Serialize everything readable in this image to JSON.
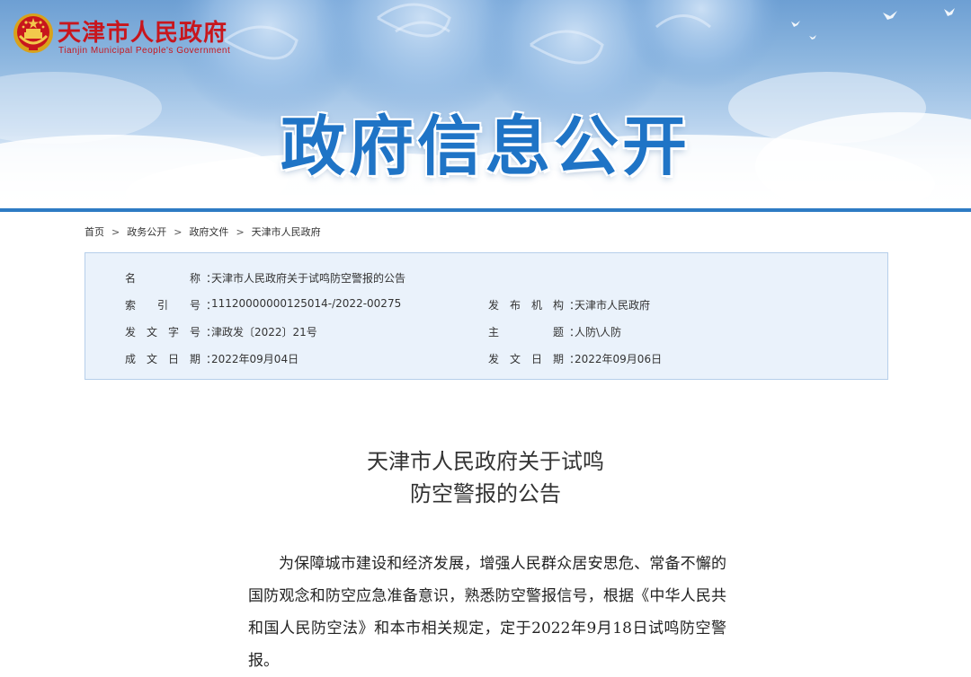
{
  "header": {
    "logo_cn": "天津市人民政府",
    "logo_en": "Tianjin Municipal People's Government",
    "banner_title": "政府信息公开"
  },
  "breadcrumb": {
    "items": [
      "首页",
      "政务公开",
      "政府文件",
      "天津市人民政府"
    ],
    "separator": ">"
  },
  "info": {
    "name": {
      "label": "名称",
      "value": "天津市人民政府关于试鸣防空警报的公告"
    },
    "index_no": {
      "label": "索引号",
      "value": "11120000000125014-/2022-00275"
    },
    "issuer": {
      "label": "发布机构",
      "value": "天津市人民政府"
    },
    "doc_no": {
      "label": "发文字号",
      "value": "津政发〔2022〕21号"
    },
    "subject": {
      "label": "主题",
      "value": "人防\\人防"
    },
    "created_date": {
      "label": "成文日期",
      "value": "2022年09月04日"
    },
    "issued_date": {
      "label": "发文日期",
      "value": "2022年09月06日"
    },
    "colon": "："
  },
  "article": {
    "title_line1": "天津市人民政府关于试鸣",
    "title_line2": "防空警报的公告",
    "paragraph1": "为保障城市建设和经济发展，增强人民群众居安思危、常备不懈的国防观念和防空应急准备意识，熟悉防空警报信号，根据《中华人民共和国人民防空法》和本市相关规定，定于2022年9月18日试鸣防空警报。"
  },
  "colors": {
    "brand_red": "#c8161d",
    "banner_title_blue": "#1f74c6",
    "accent_line": "#2e7bc4",
    "info_bg": "#eaf2fb",
    "info_border": "#b6cfea"
  }
}
